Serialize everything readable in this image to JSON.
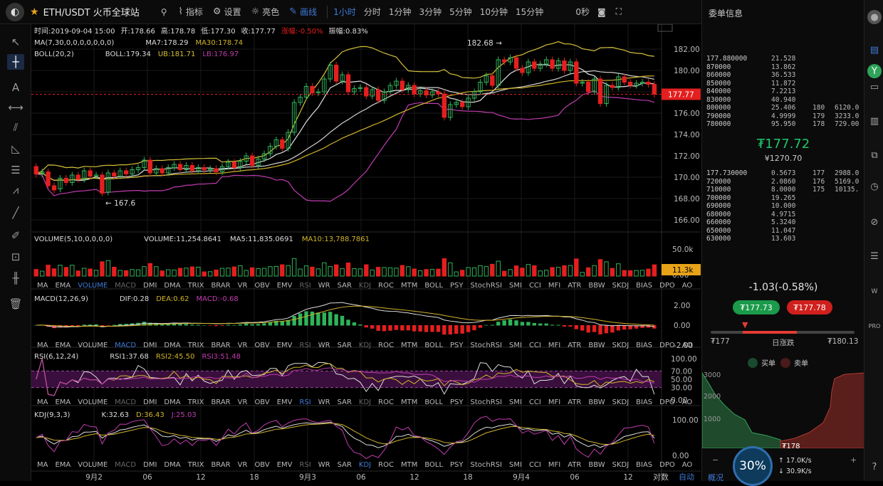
{
  "header": {
    "pair": "ETH/USDT 火币全球站",
    "menu": [
      "指标",
      "设置",
      "亮色",
      "画线"
    ],
    "periods": [
      "1小时",
      "分时",
      "1分钟",
      "3分钟",
      "5分钟",
      "10分钟",
      "15分钟"
    ],
    "countdown": "0秒"
  },
  "info": {
    "ohlc": [
      {
        "k": "时间:",
        "v": "2019-09-04 15:00"
      },
      {
        "k": "开:",
        "v": "178.66"
      },
      {
        "k": "高:",
        "v": "178.78"
      },
      {
        "k": "低:",
        "v": "177.30"
      },
      {
        "k": "收:",
        "v": "177.77"
      },
      {
        "k": "涨幅:",
        "v": "-0.50%"
      },
      {
        "k": "振幅:",
        "v": "0.83%"
      }
    ],
    "ma": [
      {
        "t": "MA(7,30,0,0,0,0,0,0,0)"
      },
      {
        "t": "MA7:178.29"
      },
      {
        "t": "MA30:178.74"
      }
    ],
    "boll": [
      {
        "t": "BOLL(20,2)"
      },
      {
        "t": "BOLL:179.34"
      },
      {
        "t": "UB:181.71"
      },
      {
        "t": "LB:176.97"
      }
    ]
  },
  "chart_data": {
    "type": "candlestick",
    "x_ticks": [
      "9月2",
      "06",
      "12",
      "18",
      "9月3",
      "06",
      "12",
      "18",
      "9月4",
      "06",
      "12"
    ],
    "y_ticks": [
      "182.00",
      "180.00",
      "178.00",
      "176.00",
      "174.00",
      "172.00",
      "170.00",
      "168.00",
      "166.00"
    ],
    "current_price": "177.77",
    "annotations": {
      "high": "182.68",
      "low": "167.6"
    },
    "candles": [
      [
        171.0,
        170.3
      ],
      [
        170.3,
        170.5
      ],
      [
        170.5,
        169.2
      ],
      [
        169.2,
        168.8
      ],
      [
        168.9,
        169.9
      ],
      [
        169.9,
        169.5
      ],
      [
        169.5,
        170.2
      ],
      [
        170.2,
        169.8
      ],
      [
        169.8,
        170.6
      ],
      [
        170.6,
        170.1
      ],
      [
        170.1,
        170.2
      ],
      [
        170.2,
        168.5
      ],
      [
        168.6,
        170.4
      ],
      [
        170.4,
        170.1
      ],
      [
        170.1,
        170.6
      ],
      [
        170.6,
        170.3
      ],
      [
        170.3,
        170.7
      ],
      [
        170.7,
        170.9
      ],
      [
        170.9,
        171.6
      ],
      [
        171.6,
        170.4
      ],
      [
        170.4,
        170.8
      ],
      [
        170.8,
        170.4
      ],
      [
        170.4,
        170.9
      ],
      [
        170.9,
        171.2
      ],
      [
        171.2,
        170.7
      ],
      [
        170.7,
        171.1
      ],
      [
        171.1,
        170.6
      ],
      [
        170.6,
        170.9
      ],
      [
        170.9,
        170.7
      ],
      [
        170.7,
        170.8
      ],
      [
        170.8,
        170.5
      ],
      [
        170.5,
        171.0
      ],
      [
        171.0,
        171.4
      ],
      [
        171.4,
        170.9
      ],
      [
        170.9,
        171.5
      ],
      [
        171.5,
        172.0
      ],
      [
        172.0,
        171.1
      ],
      [
        171.1,
        171.7
      ],
      [
        171.7,
        172.2
      ],
      [
        172.2,
        172.9
      ],
      [
        172.9,
        173.5
      ],
      [
        173.5,
        172.7
      ],
      [
        172.7,
        174.2
      ],
      [
        174.2,
        177.0
      ],
      [
        177.0,
        177.5
      ],
      [
        177.5,
        178.5
      ],
      [
        178.5,
        177.9
      ],
      [
        177.9,
        178.0
      ],
      [
        178.0,
        179.2
      ],
      [
        179.2,
        180.5
      ],
      [
        180.5,
        179.0
      ],
      [
        179.0,
        179.6
      ],
      [
        179.6,
        178.0
      ],
      [
        178.0,
        178.3
      ],
      [
        178.3,
        178.4
      ],
      [
        178.4,
        177.6
      ],
      [
        177.6,
        178.2
      ],
      [
        178.2,
        177.2
      ],
      [
        177.2,
        178.0
      ],
      [
        178.0,
        178.6
      ],
      [
        178.6,
        179.0
      ],
      [
        179.0,
        178.2
      ],
      [
        178.2,
        178.6
      ],
      [
        178.6,
        177.8
      ],
      [
        177.8,
        178.1
      ],
      [
        178.1,
        177.7
      ],
      [
        177.7,
        178.0
      ],
      [
        178.0,
        177.8
      ],
      [
        177.8,
        175.6
      ],
      [
        175.6,
        176.8
      ],
      [
        176.8,
        177.0
      ],
      [
        177.0,
        176.6
      ],
      [
        176.6,
        177.4
      ],
      [
        177.4,
        178.0
      ],
      [
        178.0,
        178.9
      ],
      [
        178.9,
        179.5
      ],
      [
        179.5,
        178.6
      ],
      [
        178.6,
        181.0
      ],
      [
        181.0,
        180.8
      ],
      [
        180.8,
        181.2
      ],
      [
        181.2,
        180.2
      ],
      [
        180.2,
        179.8
      ],
      [
        179.8,
        180.8
      ],
      [
        180.8,
        180.2
      ],
      [
        180.2,
        180.6
      ],
      [
        180.6,
        181.0
      ],
      [
        181.0,
        180.2
      ],
      [
        180.2,
        180.9
      ],
      [
        180.9,
        180.0
      ],
      [
        180.0,
        180.8
      ],
      [
        180.8,
        178.8
      ],
      [
        178.8,
        178.9
      ],
      [
        178.9,
        178.0
      ],
      [
        178.0,
        179.2
      ],
      [
        179.2,
        176.9
      ],
      [
        176.9,
        178.6
      ],
      [
        178.6,
        178.4
      ],
      [
        178.4,
        179.4
      ],
      [
        179.4,
        178.9
      ],
      [
        178.9,
        178.6
      ],
      [
        178.6,
        178.8
      ],
      [
        178.8,
        178.9
      ],
      [
        178.9,
        178.7
      ],
      [
        178.7,
        177.77
      ]
    ],
    "volume": {
      "label": "VOLUME(5,10,0,0,0,0)",
      "v": "VOLUME:11,254.8641",
      "ma5": "MA5:11,835.0691",
      "ma10": "MA10:13,788.7861",
      "ticks": [
        "50.0k",
        "0.00"
      ],
      "badge": "11.3k"
    },
    "macd": {
      "label": "MACD(12,26,9)",
      "dif": "DIF:0.28",
      "dea": "DEA:0.62",
      "m": "MACD:-0.68",
      "ticks": [
        "2.00",
        "0.00",
        "-2.00"
      ]
    },
    "rsi": {
      "label": "RSI(6,12,24)",
      "r1": "RSI1:37.68",
      "r2": "RSI2:45.50",
      "r3": "RSI3:51.48",
      "ticks": [
        "100.00",
        "70.00",
        "50.00",
        "30.00",
        "0.00"
      ]
    },
    "kdj": {
      "label": "KDJ(9,3,3)",
      "k": "K:32.63",
      "d": "D:36.43",
      "j": "J:25.03",
      "ticks": [
        "100.00",
        "0.00"
      ]
    },
    "indicator_tabs": [
      "MA",
      "EMA",
      "VOLUME",
      "MACD",
      "DMI",
      "DMA",
      "TRIX",
      "BRAR",
      "VR",
      "OBV",
      "EMV",
      "RSI",
      "WR",
      "SAR",
      "KDJ",
      "ROC",
      "MTM",
      "BOLL",
      "PSY",
      "StochRSI",
      "SMI",
      "CCI",
      "MFI",
      "ATR",
      "BBW",
      "SKDJ",
      "BIAS",
      "DPO",
      "AO"
    ],
    "bottom_right": [
      "对数",
      "自动"
    ]
  },
  "orderbook": {
    "title": "委单信息",
    "asks": [
      [
        "177.88",
        "0000",
        "21.528",
        "",
        ""
      ],
      [
        "87",
        "0000",
        "13.862",
        "",
        ""
      ],
      [
        "86",
        "0000",
        "36.533",
        "",
        ""
      ],
      [
        "85",
        "0000",
        "11.872",
        "",
        ""
      ],
      [
        "84",
        "0000",
        "7.2213",
        "",
        ""
      ],
      [
        "83",
        "0000",
        "40.940",
        "",
        ""
      ],
      [
        "80",
        "0000",
        "25.406",
        "180",
        "6120.0"
      ],
      [
        "79",
        "0000",
        "4.9999",
        "179",
        "3233.0"
      ],
      [
        "78",
        "0000",
        "95.950",
        "178",
        "729.00"
      ]
    ],
    "last": "₮177.72",
    "last_sub": "¥1270.70",
    "bids": [
      [
        "177.73",
        "0000",
        "0.5673",
        "177",
        "2988.0"
      ],
      [
        "72",
        "0000",
        "2.0860",
        "176",
        "5169.0"
      ],
      [
        "71",
        "0000",
        "8.0000",
        "175",
        "10135."
      ],
      [
        "70",
        "0000",
        "19.265",
        "",
        ""
      ],
      [
        "69",
        "0000",
        "10.000",
        "",
        ""
      ],
      [
        "68",
        "0000",
        "4.9715",
        "",
        ""
      ],
      [
        "66",
        "0000",
        "5.3240",
        "",
        ""
      ],
      [
        "65",
        "0000",
        "11.047",
        "",
        ""
      ],
      [
        "63",
        "0000",
        "13.603",
        "",
        ""
      ]
    ],
    "change": "-1.03(-0.58%)",
    "buy": "₮177.73",
    "sell": "₮177.78",
    "range_low": "₮177",
    "range_label": "日涨跌",
    "range_high": "₮180.13",
    "legend_buy": "买单",
    "legend_sell": "卖单",
    "depth_axis": [
      "3000",
      "2000",
      "1000"
    ],
    "depth_price": "₮178",
    "progress": "30%",
    "up": "17.0K/s",
    "down": "30.9K/s",
    "tab": "概况"
  }
}
